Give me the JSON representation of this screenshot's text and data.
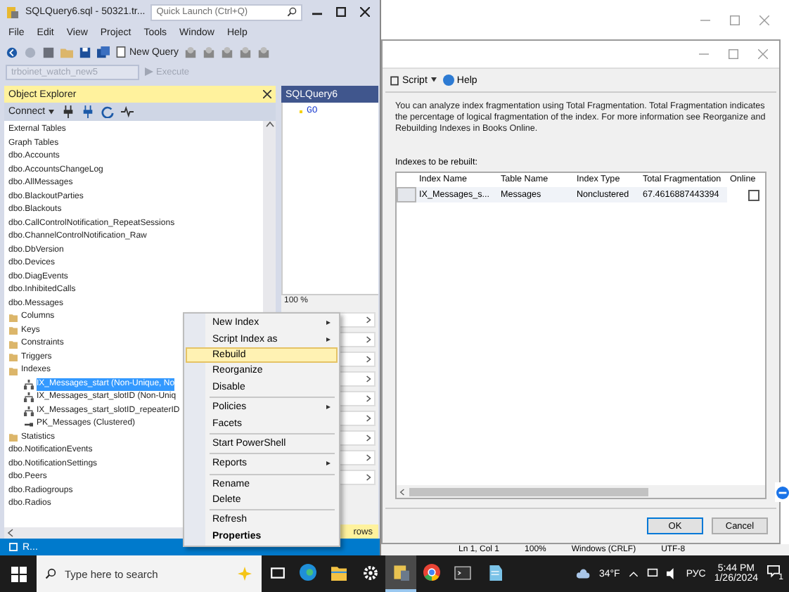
{
  "ssms": {
    "title": "SQLQuery6.sql - 50321.tr...",
    "quick_launch": {
      "placeholder": "Quick Launch (Ctrl+Q)"
    },
    "menu": [
      "File",
      "Edit",
      "View",
      "Project",
      "Tools",
      "Window",
      "Help"
    ],
    "new_query": "New Query",
    "database": "trboinet_watch_new5",
    "execute": "Execute",
    "status": "R..."
  },
  "object_explorer": {
    "title": "Object Explorer",
    "connect": "Connect",
    "tree": [
      {
        "label": "External Tables",
        "kind": "table",
        "selected": false
      },
      {
        "label": "Graph Tables",
        "kind": "table",
        "selected": false
      },
      {
        "label": "dbo.Accounts",
        "kind": "table",
        "selected": false
      },
      {
        "label": "dbo.AccountsChangeLog",
        "kind": "table",
        "selected": false
      },
      {
        "label": "dbo.AllMessages",
        "kind": "table",
        "selected": false
      },
      {
        "label": "dbo.BlackoutParties",
        "kind": "table",
        "selected": false
      },
      {
        "label": "dbo.Blackouts",
        "kind": "table",
        "selected": false
      },
      {
        "label": "dbo.CallControlNotification_RepeatSessions",
        "kind": "table",
        "selected": false
      },
      {
        "label": "dbo.ChannelControlNotification_Raw",
        "kind": "table",
        "selected": false
      },
      {
        "label": "dbo.DbVersion",
        "kind": "table",
        "selected": false
      },
      {
        "label": "dbo.Devices",
        "kind": "table",
        "selected": false
      },
      {
        "label": "dbo.DiagEvents",
        "kind": "table",
        "selected": false
      },
      {
        "label": "dbo.InhibitedCalls",
        "kind": "table",
        "selected": false
      },
      {
        "label": "dbo.Messages",
        "kind": "table",
        "selected": false,
        "children": [
          {
            "label": "Columns",
            "kind": "folder",
            "selected": false
          },
          {
            "label": "Keys",
            "kind": "folder",
            "selected": false
          },
          {
            "label": "Constraints",
            "kind": "folder",
            "selected": false
          },
          {
            "label": "Triggers",
            "kind": "folder",
            "selected": false
          },
          {
            "label": "Indexes",
            "kind": "folder",
            "selected": false,
            "children": [
              {
                "label": "IX_Messages_start (Non-Unique, No",
                "kind": "index",
                "selected": true
              },
              {
                "label": "IX_Messages_start_slotID (Non-Uniq",
                "kind": "index",
                "selected": false
              },
              {
                "label": "IX_Messages_start_slotID_repeaterID",
                "kind": "index",
                "selected": false
              },
              {
                "label": "PK_Messages (Clustered)",
                "kind": "key",
                "selected": false
              }
            ]
          },
          {
            "label": "Statistics",
            "kind": "folder",
            "selected": false
          }
        ]
      },
      {
        "label": "dbo.NotificationEvents",
        "kind": "table",
        "selected": false
      },
      {
        "label": "dbo.NotificationSettings",
        "kind": "table",
        "selected": false
      },
      {
        "label": "dbo.Peers",
        "kind": "table",
        "selected": false
      },
      {
        "label": "dbo.Radiogroups",
        "kind": "table",
        "selected": false
      },
      {
        "label": "dbo.Radios",
        "kind": "table",
        "selected": false
      }
    ]
  },
  "query": {
    "tab": "SQLQuery6",
    "code": "GO",
    "zoom": "100 %",
    "results_bar": "rows"
  },
  "context_menu": {
    "groups": [
      [
        {
          "label": "New Index",
          "submenu": true,
          "selected": false,
          "default": false
        },
        {
          "label": "Script Index as",
          "submenu": true,
          "selected": false,
          "default": false
        },
        {
          "label": "Rebuild",
          "submenu": false,
          "selected": true,
          "default": false
        },
        {
          "label": "Reorganize",
          "submenu": false,
          "selected": false,
          "default": false
        },
        {
          "label": "Disable",
          "submenu": false,
          "selected": false,
          "default": false
        }
      ],
      [
        {
          "label": "Policies",
          "submenu": true,
          "selected": false,
          "default": false
        },
        {
          "label": "Facets",
          "submenu": false,
          "selected": false,
          "default": false
        }
      ],
      [
        {
          "label": "Start PowerShell",
          "submenu": false,
          "selected": false,
          "default": false
        }
      ],
      [
        {
          "label": "Reports",
          "submenu": true,
          "selected": false,
          "default": false
        }
      ],
      [
        {
          "label": "Rename",
          "submenu": false,
          "selected": false,
          "default": false
        },
        {
          "label": "Delete",
          "submenu": false,
          "selected": false,
          "default": false
        }
      ],
      [
        {
          "label": "Refresh",
          "submenu": false,
          "selected": false,
          "default": false
        },
        {
          "label": "Properties",
          "submenu": false,
          "selected": false,
          "default": true
        }
      ]
    ]
  },
  "dialog": {
    "script": "Script",
    "help": "Help",
    "description": "You can analyze index fragmentation using Total Fragmentation. Total Fragmentation indicates the percentage of logical fragmentation of the index. For more information see Reorganize and Rebuilding Indexes in Books Online.",
    "list_label": "Indexes to be rebuilt:",
    "columns": [
      "Index Name",
      "Table Name",
      "Index Type",
      "Total Fragmentation",
      "Online"
    ],
    "rows": [
      {
        "cells": [
          "IX_Messages_s...",
          "Messages",
          "Nonclustered",
          "67.4616887443394"
        ],
        "online": false
      }
    ],
    "buttons": [
      {
        "label": "OK",
        "default": true
      },
      {
        "label": "Cancel",
        "default": false
      }
    ]
  },
  "editor_status": [
    "Ln 1, Col 1",
    "100%",
    "Windows (CRLF)",
    "UTF-8"
  ],
  "taskbar": {
    "search": {
      "placeholder": "Type here to search"
    },
    "apps": [
      {
        "kind": "taskview",
        "active": false
      },
      {
        "kind": "edge",
        "active": false
      },
      {
        "kind": "explorer",
        "active": false
      },
      {
        "kind": "settings",
        "active": false
      },
      {
        "kind": "ssms",
        "active": true
      },
      {
        "kind": "chrome",
        "active": false
      },
      {
        "kind": "terminal",
        "active": false
      },
      {
        "kind": "notepad",
        "active": false
      }
    ],
    "weather": "34°F",
    "language": "РУС",
    "time": "5:44 PM",
    "date": "1/26/2024",
    "notifications": "1"
  }
}
